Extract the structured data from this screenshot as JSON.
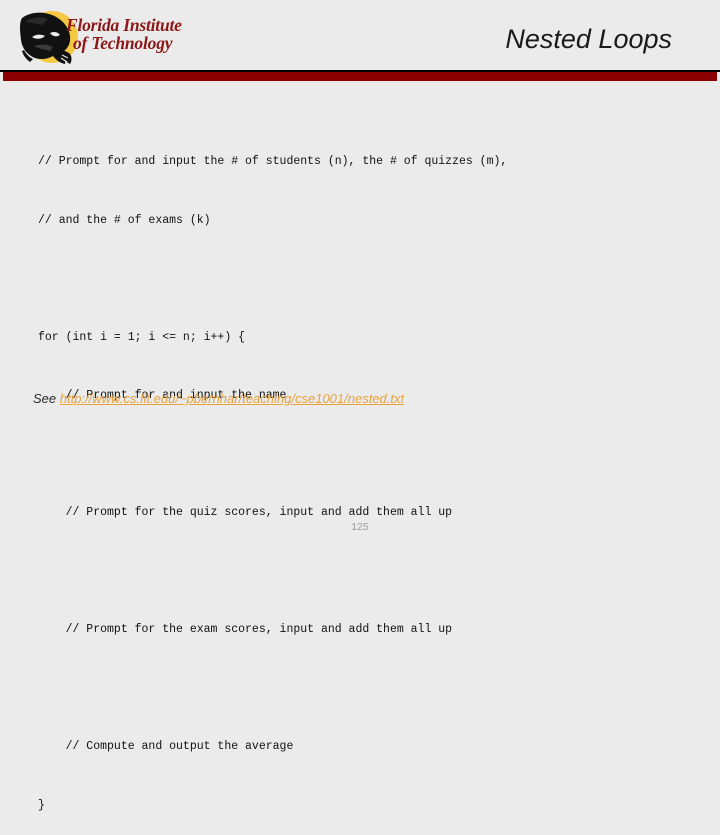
{
  "header": {
    "title": "Nested Loops",
    "logo": {
      "icon": "panther-head-icon",
      "wordmark_line1": "Florida Institute",
      "wordmark_line2": "of Technology",
      "disc_color": "#f5c842",
      "panther_color": "#111111",
      "wordmark_color": "#8a1818"
    },
    "rule_black_color": "#000000",
    "rule_red_color": "#8b0000"
  },
  "code": {
    "lines": [
      "// Prompt for and input the # of students (n), the # of quizzes (m),",
      "// and the # of exams (k)",
      "",
      "for (int i = 1; i <= n; i++) {",
      "    // Prompt for and input the name",
      "",
      "    // Prompt for the quiz scores, input and add them all up",
      "",
      "    // Prompt for the exam scores, input and add them all up",
      "",
      "    // Compute and output the average",
      "}"
    ]
  },
  "reference": {
    "prefix": "See ",
    "url_text": "http://www.cs.fit.edu/~pbernhar/teaching/cse1001/nested.txt",
    "link_color": "#e8a33d"
  },
  "footer": {
    "page_number": "125"
  }
}
